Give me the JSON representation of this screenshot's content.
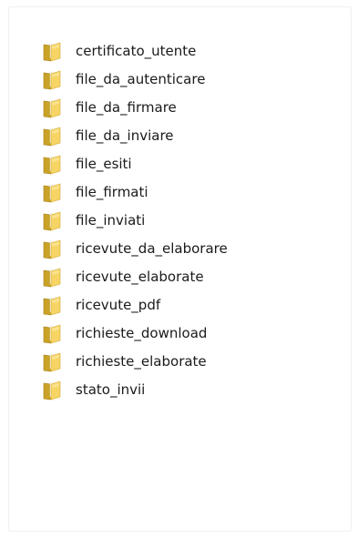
{
  "folders": [
    {
      "label": "certificato_utente",
      "icon": "folder-icon"
    },
    {
      "label": "file_da_autenticare",
      "icon": "folder-icon"
    },
    {
      "label": "file_da_firmare",
      "icon": "folder-icon"
    },
    {
      "label": "file_da_inviare",
      "icon": "folder-icon"
    },
    {
      "label": "file_esiti",
      "icon": "folder-icon"
    },
    {
      "label": "file_firmati",
      "icon": "folder-icon"
    },
    {
      "label": "file_inviati",
      "icon": "folder-icon"
    },
    {
      "label": "ricevute_da_elaborare",
      "icon": "folder-icon"
    },
    {
      "label": "ricevute_elaborate",
      "icon": "folder-icon"
    },
    {
      "label": "ricevute_pdf",
      "icon": "folder-icon"
    },
    {
      "label": "richieste_download",
      "icon": "folder-icon"
    },
    {
      "label": "richieste_elaborate",
      "icon": "folder-icon"
    },
    {
      "label": "stato_invii",
      "icon": "folder-icon"
    }
  ],
  "colors": {
    "folder_back": "#c9a227",
    "folder_front": "#f7d565",
    "folder_paper": "#ffffff"
  }
}
